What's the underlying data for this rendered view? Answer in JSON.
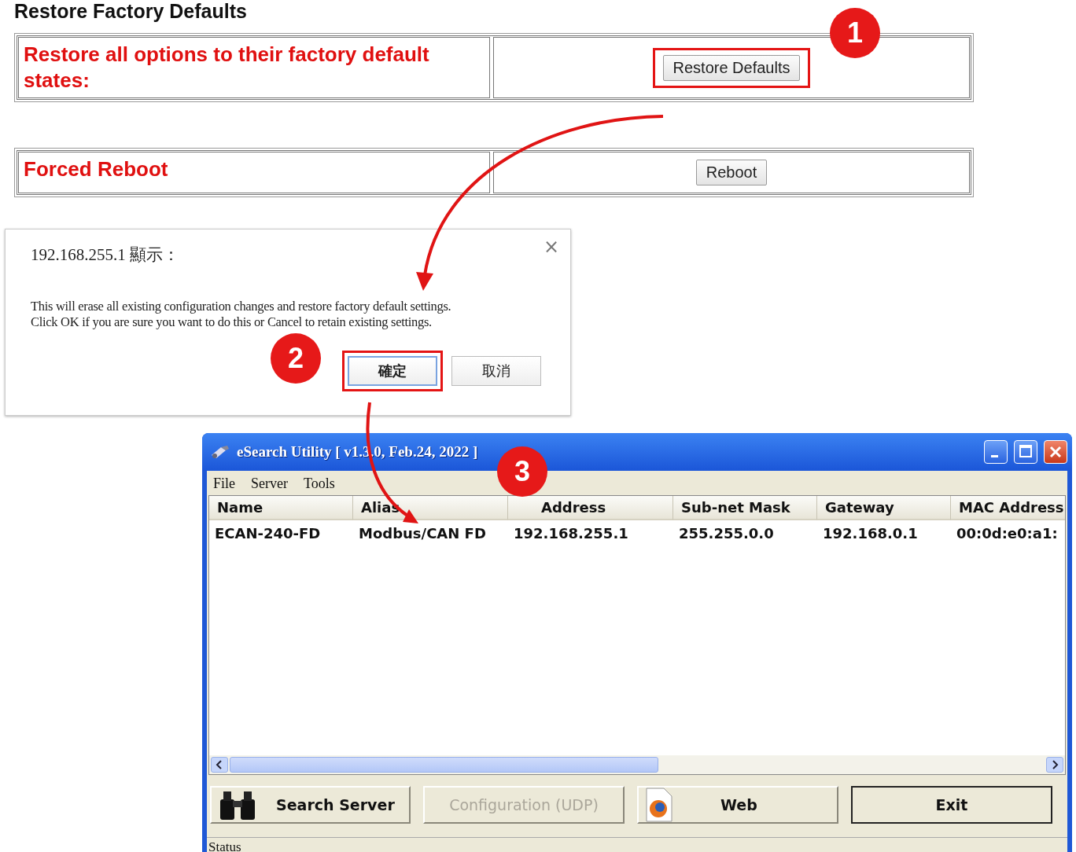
{
  "heading": "Restore Factory Defaults",
  "settings": [
    {
      "label": "Restore all options to their factory default states:",
      "button": "Restore Defaults",
      "highlighted": true
    },
    {
      "label": "Forced Reboot",
      "button": "Reboot",
      "highlighted": false
    }
  ],
  "dialog": {
    "title": "192.168.255.1 顯示：",
    "close": "×",
    "message": [
      "This will erase all existing configuration changes and restore factory default settings.",
      "Click OK if you are sure you want to do this or Cancel to retain existing settings."
    ],
    "buttons": [
      {
        "label": "確定",
        "focused": true,
        "highlighted": true
      },
      {
        "label": "取消",
        "focused": false,
        "highlighted": false
      }
    ]
  },
  "window": {
    "title": "eSearch Utility [ v1.3.0, Feb.24, 2022 ]",
    "menu": [
      "File",
      "Server",
      "Tools"
    ],
    "columns": [
      "Name",
      "Alias",
      "Address",
      "Sub-net Mask",
      "Gateway",
      "MAC Address"
    ],
    "rows": [
      [
        "ECAN-240-FD",
        "Modbus/CAN FD",
        "192.168.255.1",
        "255.255.0.0",
        "192.168.0.1",
        "00:0d:e0:a1:"
      ]
    ],
    "buttons": [
      {
        "label": "Search Server",
        "disabled": false,
        "default": false
      },
      {
        "label": "Configuration (UDP)",
        "disabled": true,
        "default": false
      },
      {
        "label": "Web",
        "disabled": false,
        "default": false
      },
      {
        "label": "Exit",
        "disabled": false,
        "default": true
      }
    ],
    "status_bar": "Status"
  },
  "annotations": [
    {
      "number": "1"
    },
    {
      "number": "2"
    },
    {
      "number": "3"
    }
  ]
}
